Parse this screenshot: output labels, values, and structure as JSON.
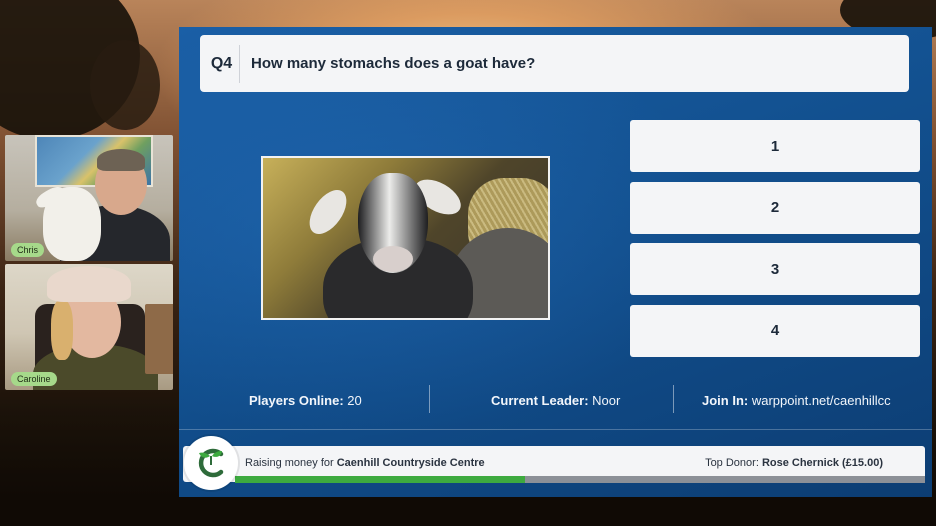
{
  "participants": [
    {
      "name": "Chris"
    },
    {
      "name": "Caroline"
    }
  ],
  "question": {
    "number": "Q4",
    "text": "How many stomachs does a goat have?"
  },
  "answers": [
    "1",
    "2",
    "3",
    "4"
  ],
  "stats": {
    "players_label": "Players Online:",
    "players_value": "20",
    "leader_label": "Current Leader:",
    "leader_value": "Noor",
    "join_label": "Join In:",
    "join_value": "warppoint.net/caenhillcc"
  },
  "fundraiser": {
    "prefix": "Raising money for",
    "cause": "Caenhill Countryside Centre",
    "donor_label": "Top Donor:",
    "donor_value": "Rose Chernick (£15.00)",
    "progress_fraction": 0.42
  },
  "colors": {
    "panel_blue": "#12508f",
    "progress_green": "#3daa3f",
    "label_green": "#a6d98a"
  }
}
